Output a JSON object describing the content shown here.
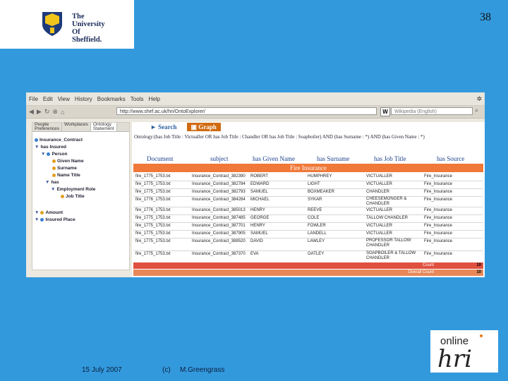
{
  "slide": {
    "number": "38",
    "date": "15 July 2007",
    "copyright": "(c)",
    "author": "M.Greengrass",
    "university_logo_lines": [
      "The",
      "University",
      "Of",
      "Sheffield."
    ],
    "hri_logo": {
      "top": "online",
      "bottom": "hri"
    }
  },
  "browser": {
    "menu": [
      "File",
      "Edit",
      "View",
      "History",
      "Bookmarks",
      "Tools",
      "Help"
    ],
    "url": "http://www.shef.ac.uk/hri/OntoExplorer/",
    "search_engine_letter": "W",
    "search_placeholder": "Wikipedia (English)",
    "left_tabs": [
      "People",
      "Workplaces",
      "Ontology",
      "Ontology",
      "Preferences",
      "Statement"
    ],
    "tree": [
      "Insurance_Contract",
      "has Insured",
      "Person",
      "Given Name",
      "Surname",
      "Name Title",
      "has",
      "Employment Role",
      "Job Title",
      "Amount",
      "Insured Place"
    ],
    "tabs": {
      "search": "Search",
      "graph": "Graph"
    },
    "query": "Ontology:(has Job Title : Victualler OR has Job Title : Chandler OR has Job Title : Soapboiler) AND (has Surname : *) AND (has Given Name : *)",
    "columns": [
      "Document",
      "subject",
      "has Given Name",
      "has Surname",
      "has Job Title",
      "has Source"
    ],
    "group": "Fire Insurance",
    "rows": [
      [
        "fire_1775_1753.txt",
        "Insurance_Contract_382390",
        "ROBERT",
        "HUMPHREY",
        "VICTUALLER",
        "Fire_Insurance"
      ],
      [
        "fire_1775_1753.txt",
        "Insurance_Contract_382784",
        "EDWARD",
        "LIGHT",
        "VICTUALLER",
        "Fire_Insurance"
      ],
      [
        "fire_1775_1753.txt",
        "Insurance_Contract_382793",
        "SAMUEL",
        "BOXMEAKER",
        "CHANDLER",
        "Fire_Insurance"
      ],
      [
        "fire_1776_1753.txt",
        "Insurance_Contract_384284",
        "MICHAEL",
        "SYKAR",
        "CHEESEMONGER & CHANDLER",
        "Fire_Insurance"
      ],
      [
        "fire_1776_1753.txt",
        "Insurance_Contract_385013",
        "HENRY",
        "REEVE",
        "VICTUALLER",
        "Fire_Insurance"
      ],
      [
        "fire_1775_1753.txt",
        "Insurance_Contract_387485",
        "GEORGE",
        "COLE",
        "TALLOW CHANDLER",
        "Fire_Insurance"
      ],
      [
        "fire_1775_1753.txt",
        "Insurance_Contract_387701",
        "HENRY",
        "FOWLER",
        "VICTUALLER",
        "Fire_Insurance"
      ],
      [
        "fire_1775_1753.txt",
        "Insurance_Contract_387905",
        "SAMUEL",
        "LANDELL",
        "VICTUALLER",
        "Fire_Insurance"
      ],
      [
        "fire_1775_1753.txt",
        "Insurance_Contract_388520",
        "DAVID",
        "LAWLEY",
        "PROFESSOR TALLOW CHANDLER",
        "Fire_Insurance"
      ],
      [
        "fire_1775_1753.txt",
        "Insurance_Contract_387370",
        "EVA",
        "OATLEY",
        "SOAPBOILER & TALLOW CHANDLER",
        "Fire_Insurance"
      ]
    ],
    "count_label": "Count",
    "count_value": "10",
    "overall_label": "Overall Count",
    "overall_value": "10",
    "colors": {
      "accent": "#d06a10",
      "fire_band": "#f07838",
      "count_band": "#e05040",
      "overall_band": "#e88858",
      "slide_bg": "#3399dd"
    }
  }
}
